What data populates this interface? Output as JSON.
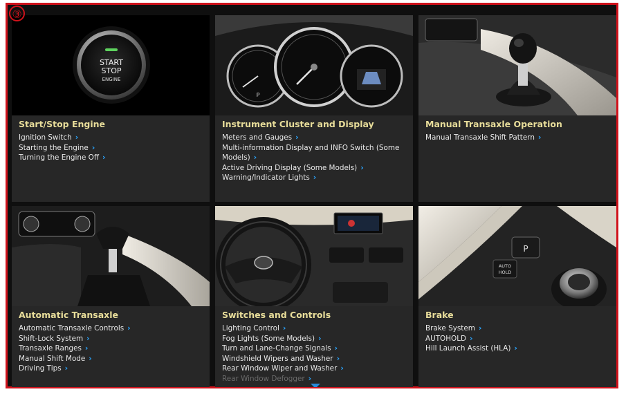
{
  "badge": "③",
  "cards": [
    {
      "title": "Start/Stop Engine",
      "image_text": [
        "START",
        "STOP",
        "ENGINE"
      ],
      "links": [
        "Ignition Switch",
        "Starting the Engine",
        "Turning the Engine Off"
      ]
    },
    {
      "title": "Instrument Cluster and Display",
      "links": [
        "Meters and Gauges",
        "Multi-information Display and INFO Switch (Some Models)",
        "Active Driving Display (Some Models)",
        "Warning/Indicator Lights"
      ]
    },
    {
      "title": "Manual Transaxle Operation",
      "links": [
        "Manual Transaxle Shift Pattern"
      ]
    },
    {
      "title": "Automatic Transaxle",
      "links": [
        "Automatic Transaxle Controls",
        "Shift-Lock System",
        "Transaxle Ranges",
        "Manual Shift Mode",
        "Driving Tips"
      ]
    },
    {
      "title": "Switches and Controls",
      "links": [
        "Lighting Control",
        "Fog Lights (Some Models)",
        "Turn and Lane-Change Signals",
        "Windshield Wipers and Washer",
        "Rear Window Wiper and Washer",
        "Rear Window Defogger"
      ]
    },
    {
      "title": "Brake",
      "image_text": [
        "AUTO",
        "HOLD"
      ],
      "links": [
        "Brake System",
        "AUTOHOLD",
        "Hill Launch Assist (HLA)"
      ]
    }
  ],
  "colors": {
    "accent_red": "#d0121b",
    "title_yellow": "#e8dd9a",
    "chevron_blue": "#2aa5ff"
  },
  "icons": {
    "link": "chevron-right-icon",
    "scroll": "triangle-down-icon"
  }
}
